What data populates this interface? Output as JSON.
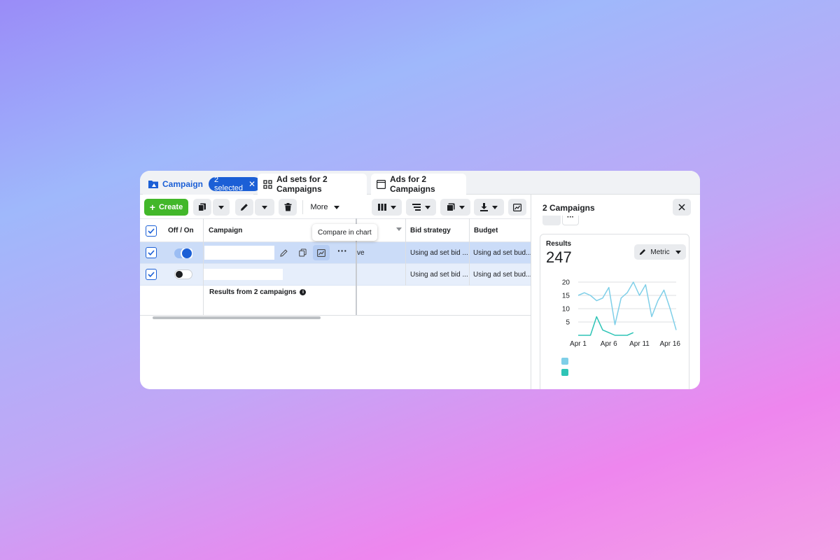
{
  "tabs": [
    {
      "label": "Campaign",
      "badge": "2 selected",
      "icon": "campaign-folder-icon"
    },
    {
      "label": "Ad sets for 2 Campaigns",
      "icon": "grid-icon"
    },
    {
      "label": "Ads for 2 Campaigns",
      "icon": "window-icon"
    }
  ],
  "toolbar": {
    "create_label": "Create",
    "more_label": "More"
  },
  "table": {
    "headers": {
      "off_on": "Off / On",
      "campaign": "Campaign",
      "bid_strategy": "Bid strategy",
      "budget": "Budget"
    },
    "rows": [
      {
        "delivery_fragment": "ve",
        "bid_strategy": "Using ad set bid ...",
        "budget": "Using ad set bud...",
        "on": true
      },
      {
        "delivery_fragment": "",
        "bid_strategy": "Using ad set bid ...",
        "budget": "Using ad set bud...",
        "on": false
      }
    ],
    "summary": "Results from 2 campaigns"
  },
  "tooltip": "Compare in chart",
  "panel": {
    "title": "2 Campaigns",
    "card": {
      "label": "Results",
      "value": "247",
      "metric_label": "Metric"
    }
  },
  "colors": {
    "accent": "#1b5fd6",
    "create": "#42b72a",
    "series_1": "#7fcfe8",
    "series_2": "#2ec4b6"
  },
  "chart_data": {
    "type": "line",
    "x_ticks": [
      "Apr 1",
      "Apr 6",
      "Apr 11",
      "Apr 16"
    ],
    "y_ticks": [
      5,
      10,
      15,
      20
    ],
    "ylim": [
      0,
      20
    ],
    "x": [
      1,
      2,
      3,
      4,
      5,
      6,
      7,
      8,
      9,
      10,
      11,
      12,
      13,
      14,
      15,
      16,
      17
    ],
    "series": [
      {
        "values": [
          15,
          16,
          15,
          13,
          14,
          18,
          4,
          14,
          16,
          20,
          15,
          19,
          7,
          13,
          17,
          10,
          2
        ]
      },
      {
        "values": [
          0,
          0,
          0,
          7,
          2,
          1,
          0,
          0,
          0,
          1,
          null,
          null,
          null,
          null,
          null,
          null,
          null
        ]
      }
    ],
    "grid": true
  }
}
